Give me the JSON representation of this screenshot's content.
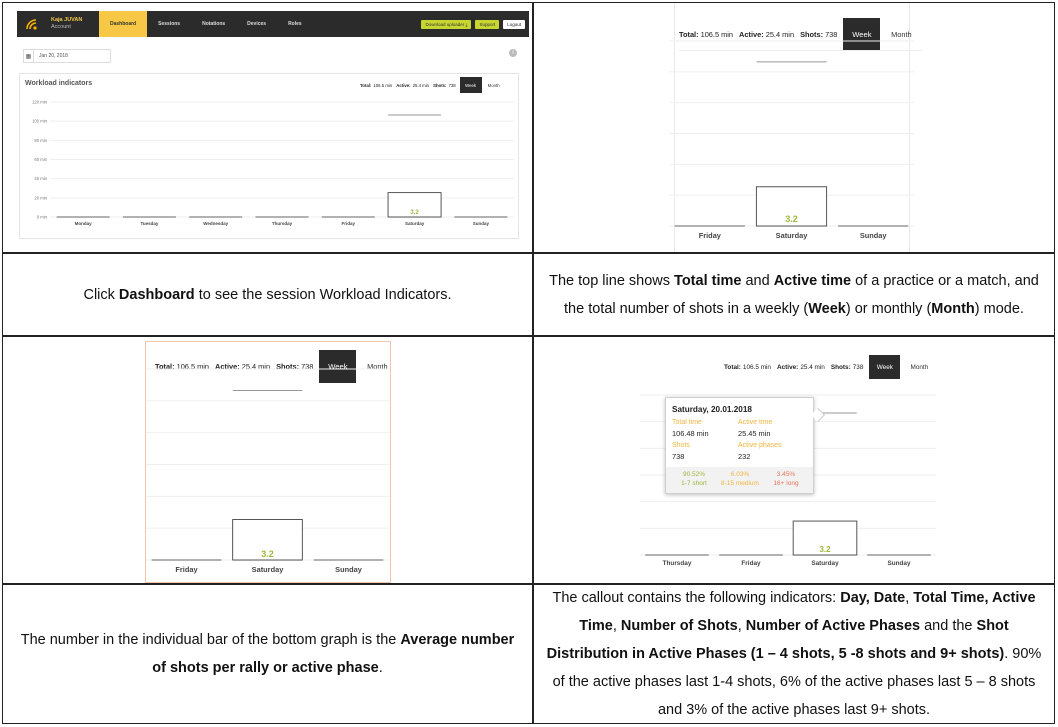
{
  "app": {
    "account_name": "Kaja JUVAN",
    "account_sub": "Account",
    "nav": [
      "Dashboard",
      "Sessions",
      "Notations",
      "Devices",
      "Roles"
    ],
    "download_btn": "Download uploader ⤓",
    "support_btn": "Support",
    "logout_btn": "Logout",
    "date_value": "Jan 20, 2018",
    "panel_title": "Workload indicators"
  },
  "stats": {
    "total_label": "Total:",
    "total_value": "106.5 min",
    "active_label": "Active:",
    "active_value": "25.4 min",
    "shots_label": "Shots:",
    "shots_value": "738",
    "week_btn": "Week",
    "month_btn": "Month"
  },
  "chart_data": {
    "type": "bar",
    "categories": [
      "Monday",
      "Tuesday",
      "Wednesday",
      "Thursday",
      "Friday",
      "Saturday",
      "Sunday"
    ],
    "values": [
      0,
      0,
      0,
      0,
      0,
      25.45,
      0
    ],
    "total_time": [
      0,
      0,
      0,
      0,
      0,
      106.48,
      0
    ],
    "bar_labels": [
      "",
      "",
      "",
      "",
      "",
      "3.2",
      ""
    ],
    "yticks": [
      "0 min",
      "20 min",
      "40 min",
      "60 min",
      "80 min",
      "100 min",
      "120 min"
    ],
    "ylim": [
      0,
      120
    ],
    "grid": true
  },
  "callout": {
    "date": "Saturday, 20.01.2018",
    "total_time_label": "Total time",
    "total_time_value": "106.48 min",
    "active_time_label": "Active time",
    "active_time_value": "25.45 min",
    "shots_label": "Shots",
    "shots_value": "738",
    "active_phases_label": "Active phases",
    "active_phases_value": "232",
    "dist": [
      {
        "pct": "90.52%",
        "label": "1-7 short",
        "color": "#9bb83a"
      },
      {
        "pct": "6.03%",
        "label": "8-15 medium",
        "color": "#f1b440"
      },
      {
        "pct": "3.45%",
        "label": "16+ long",
        "color": "#e8735a"
      }
    ]
  },
  "colors": {
    "accent_yellow": "#f6c846",
    "dark": "#2b2b2b",
    "green_label": "#9bb83a"
  },
  "captions": {
    "c3_pre": "Click ",
    "c3_b1": "Dashboard",
    "c3_post": " to see the session Workload Indicators.",
    "c4_1": "The top line shows ",
    "c4_b1": "Total time",
    "c4_2": " and ",
    "c4_b2": "Active time",
    "c4_3": " of a practice or a match, and the total number of shots in a weekly (",
    "c4_b3": "Week",
    "c4_4": ") or monthly (",
    "c4_b4": "Month",
    "c4_5": ") mode.",
    "c7_1": "The number in the individual bar of the bottom graph is the ",
    "c7_b1": "Average number of shots per rally or active phase",
    "c7_2": ".",
    "c8_1": "The callout contains the following indicators: ",
    "c8_b1": "Day, Date",
    "c8_2": ", ",
    "c8_b2": "Total Time, Active Time",
    "c8_3": ", ",
    "c8_b3": "Number of Shots",
    "c8_4": ", ",
    "c8_b4": "Number of Active Phases",
    "c8_5": " and the ",
    "c8_b5": "Shot Distribution in Active Phases (1 – 4 shots, 5 -8 shots and 9+ shots)",
    "c8_6": ". 90% of the active phases last 1-4 shots, 6% of the active phases last 5 – 8 shots and 3% of the active phases last 9+ shots."
  }
}
